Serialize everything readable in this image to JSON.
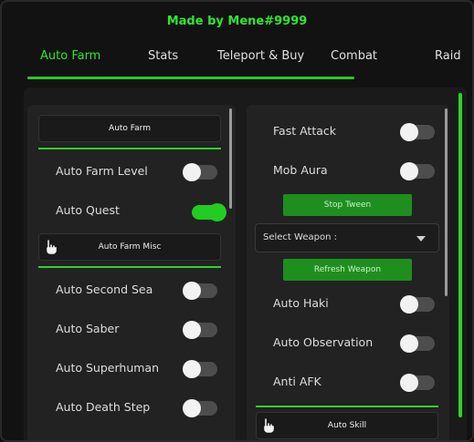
{
  "window": {
    "title": "Made by Mene#9999"
  },
  "tabs": [
    {
      "label": "Auto Farm",
      "active": true
    },
    {
      "label": "Stats"
    },
    {
      "label": "Teleport & Buy"
    },
    {
      "label": "Combat"
    },
    {
      "label": "Raid"
    }
  ],
  "left": {
    "section_auto_farm": "Auto Farm",
    "auto_farm_level": {
      "label": "Auto Farm Level",
      "on": false
    },
    "auto_quest": {
      "label": "Auto Quest",
      "on": true
    },
    "section_auto_farm_misc": "Auto Farm Misc",
    "misc": [
      {
        "label": "Auto Second Sea",
        "on": false
      },
      {
        "label": "Auto Saber",
        "on": false
      },
      {
        "label": "Auto Superhuman",
        "on": false
      },
      {
        "label": "Auto Death Step",
        "on": false
      }
    ]
  },
  "right": {
    "fast_attack": {
      "label": "Fast Attack",
      "on": false
    },
    "mob_aura": {
      "label": "Mob Aura",
      "on": false
    },
    "stop_tween": "Stop Tween",
    "select_weapon": {
      "label": "Select Weapon :"
    },
    "refresh_weapon": "Refresh Weapon",
    "auto_haki": {
      "label": "Auto Haki",
      "on": false
    },
    "auto_observation": {
      "label": "Auto Observation",
      "on": false
    },
    "anti_afk": {
      "label": "Anti AFK",
      "on": false
    },
    "section_auto_skill": "Auto Skill"
  },
  "colors": {
    "accent": "#2ee62e",
    "bg": "#121212",
    "panel": "#222222"
  }
}
